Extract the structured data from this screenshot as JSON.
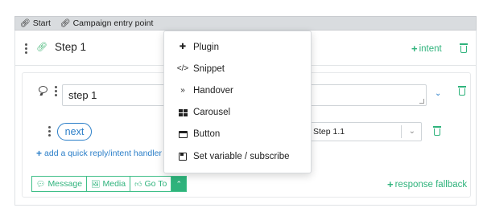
{
  "breadcrumbs": {
    "start": "Start",
    "entry_point": "Campaign entry point"
  },
  "step": {
    "title": "Step 1",
    "intent_label": "intent"
  },
  "message": {
    "text_value": "step 1",
    "quick_reply_label": "next",
    "target_select_value": "Step 1.1",
    "add_quick_reply_label": "add a quick reply/intent handler"
  },
  "toolbar": {
    "message_label": "Message",
    "media_label": "Media",
    "goto_label": "Go To",
    "response_fallback_label": "response fallback"
  },
  "menu": {
    "items": [
      {
        "label": "Plugin",
        "icon": "puzzle-icon"
      },
      {
        "label": "Snippet",
        "icon": "code-icon"
      },
      {
        "label": "Handover",
        "icon": "double-chevron-right-icon"
      },
      {
        "label": "Carousel",
        "icon": "grid-icon"
      },
      {
        "label": "Button",
        "icon": "button-icon"
      },
      {
        "label": "Set variable / subscribe",
        "icon": "save-icon"
      }
    ]
  },
  "colors": {
    "accent_green": "#2fb37c",
    "link_blue": "#2a7ec8",
    "topbar_gray": "#d9dcdf"
  }
}
